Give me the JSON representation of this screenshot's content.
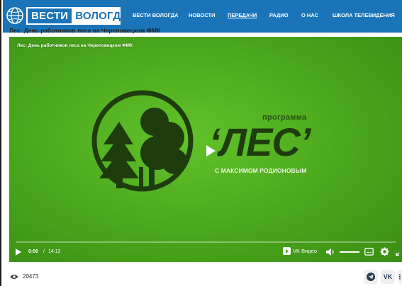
{
  "header": {
    "logo": {
      "part1": "ВЕСТИ",
      "part2": "ВОЛОГДА"
    },
    "nav": [
      {
        "label": "ВЕСТИ ВОЛОГДА",
        "active": false
      },
      {
        "label": "НОВОСТИ",
        "active": false
      },
      {
        "label": "ПЕРЕДАЧИ",
        "active": true
      },
      {
        "label": "РАДИО",
        "active": false
      },
      {
        "label": "О НАС",
        "active": false
      },
      {
        "label": "ШКОЛА ТЕЛЕВИДЕНИЯ",
        "active": false
      }
    ]
  },
  "article": {
    "title": "Лес: День работников леса на Череповецком ФМК"
  },
  "player": {
    "title": "Лес: День работников леса на Череповецком ФМК",
    "program_label": "программа",
    "program_name": "‘ЛЕС’",
    "program_host": "С МАКСИМОМ РОДИОНОВЫМ",
    "time_current": "0:00",
    "time_separator": "/",
    "time_total": "14:12",
    "progress": 0,
    "volume": 1,
    "brand": "VK Видео",
    "colors": {
      "background": "#4aa61c",
      "logo_dark": "#1e3c0c",
      "header": "#1b74b8"
    }
  },
  "footer": {
    "views": "20473",
    "share": [
      {
        "name": "telegram-icon"
      },
      {
        "name": "vk-icon",
        "label": "vk"
      },
      {
        "name": "more-icon",
        "label": "⋮"
      }
    ]
  }
}
